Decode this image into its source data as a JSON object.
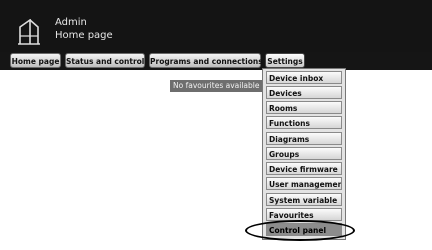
{
  "header": {
    "user": "Admin",
    "page": "Home page"
  },
  "nav": {
    "items": [
      {
        "label": "Home page"
      },
      {
        "label": "Status and control"
      },
      {
        "label": "Programs and connections"
      },
      {
        "label": "Settings"
      }
    ]
  },
  "favourites_notice": "No favourites available",
  "settings_menu": {
    "items": [
      {
        "label": "Device inbox"
      },
      {
        "label": "Devices"
      },
      {
        "label": "Rooms"
      },
      {
        "label": "Functions"
      },
      {
        "label": "Diagrams"
      },
      {
        "label": "Groups"
      },
      {
        "label": "Device firmware"
      },
      {
        "label": "User management"
      },
      {
        "label": "System variable"
      },
      {
        "label": "Favourites"
      },
      {
        "label": "Control panel"
      }
    ],
    "highlighted": "Control panel"
  },
  "icons": {
    "logo": "house-logo-icon"
  }
}
